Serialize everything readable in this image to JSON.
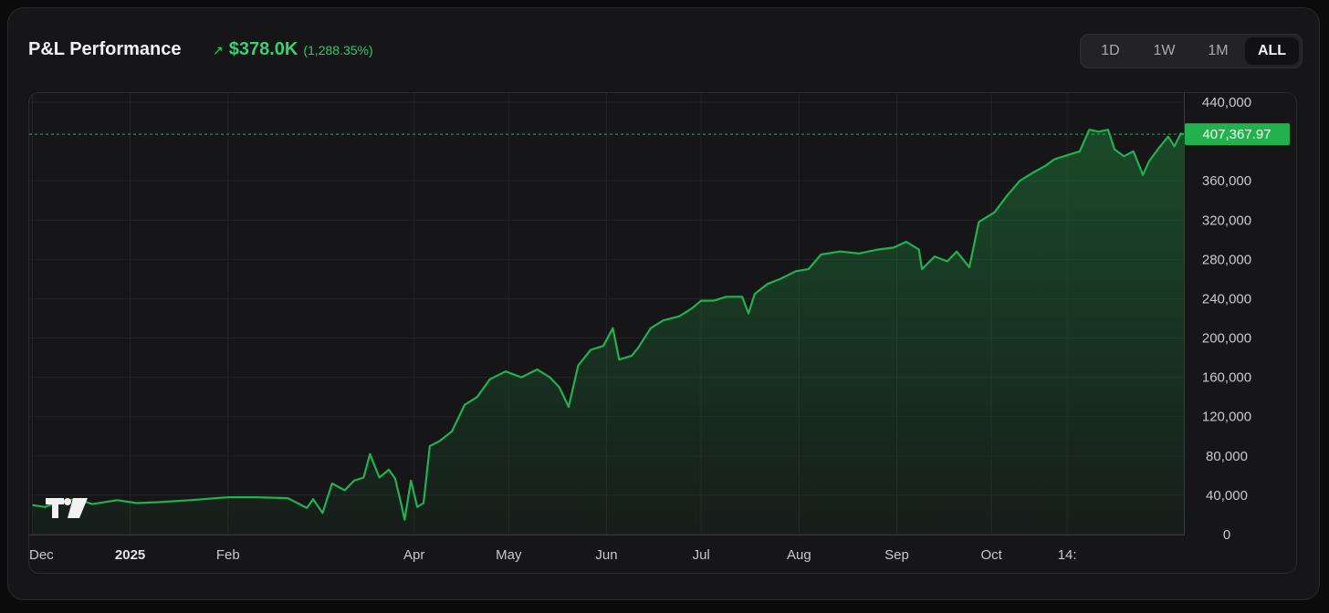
{
  "header": {
    "title": "P&L Performance",
    "trend_icon": "trending-up-icon",
    "pnl_value": "$378.0K",
    "pnl_percent": "(1,288.35%)"
  },
  "range_selector": {
    "options": [
      "1D",
      "1W",
      "1M",
      "ALL"
    ],
    "selected": "ALL"
  },
  "colors": {
    "accent_green": "#22b14c",
    "background": "#161618"
  },
  "chart_data": {
    "type": "area",
    "title": "",
    "xlabel": "",
    "ylabel": "",
    "ylim": [
      0,
      440000
    ],
    "y_ticks": [
      0,
      40000,
      80000,
      120000,
      160000,
      200000,
      240000,
      280000,
      320000,
      360000,
      440000
    ],
    "y_tick_labels": [
      "0",
      "40,000",
      "80,000",
      "120,000",
      "160,000",
      "200,000",
      "240,000",
      "280,000",
      "320,000",
      "360,000",
      "440,000"
    ],
    "x_tick_labels": [
      {
        "label": "Dec",
        "date": "2024-12-01",
        "bold": false
      },
      {
        "label": "2025",
        "date": "2025-01-01",
        "bold": true
      },
      {
        "label": "Feb",
        "date": "2025-02-01",
        "bold": false
      },
      {
        "label": "Apr",
        "date": "2025-04-01",
        "bold": false
      },
      {
        "label": "May",
        "date": "2025-05-01",
        "bold": false
      },
      {
        "label": "Jun",
        "date": "2025-06-01",
        "bold": false
      },
      {
        "label": "Jul",
        "date": "2025-07-01",
        "bold": false
      },
      {
        "label": "Aug",
        "date": "2025-08-01",
        "bold": false
      },
      {
        "label": "Sep",
        "date": "2025-09-01",
        "bold": false
      },
      {
        "label": "Oct",
        "date": "2025-10-01",
        "bold": false
      },
      {
        "label": "14:",
        "date": "2025-10-25",
        "bold": false
      }
    ],
    "grid": true,
    "last_value": 407367.97,
    "last_value_label": "407,367.97",
    "series": [
      {
        "points": [
          [
            "2024-12-01",
            30000
          ],
          [
            "2024-12-05",
            28000
          ],
          [
            "2024-12-10",
            34000
          ],
          [
            "2024-12-15",
            36000
          ],
          [
            "2024-12-20",
            31000
          ],
          [
            "2024-12-28",
            35000
          ],
          [
            "2025-01-03",
            32000
          ],
          [
            "2025-01-10",
            33000
          ],
          [
            "2025-01-20",
            35000
          ],
          [
            "2025-02-01",
            38000
          ],
          [
            "2025-02-10",
            38000
          ],
          [
            "2025-02-20",
            37000
          ],
          [
            "2025-02-26",
            27000
          ],
          [
            "2025-02-28",
            36000
          ],
          [
            "2025-03-03",
            22000
          ],
          [
            "2025-03-06",
            52000
          ],
          [
            "2025-03-10",
            45000
          ],
          [
            "2025-03-13",
            55000
          ],
          [
            "2025-03-16",
            58000
          ],
          [
            "2025-03-18",
            82000
          ],
          [
            "2025-03-21",
            58000
          ],
          [
            "2025-03-24",
            66000
          ],
          [
            "2025-03-26",
            57000
          ],
          [
            "2025-03-28",
            30000
          ],
          [
            "2025-03-29",
            15000
          ],
          [
            "2025-03-31",
            55000
          ],
          [
            "2025-04-02",
            28000
          ],
          [
            "2025-04-04",
            32000
          ],
          [
            "2025-04-06",
            90000
          ],
          [
            "2025-04-09",
            95000
          ],
          [
            "2025-04-13",
            105000
          ],
          [
            "2025-04-17",
            132000
          ],
          [
            "2025-04-21",
            140000
          ],
          [
            "2025-04-25",
            158000
          ],
          [
            "2025-04-30",
            166000
          ],
          [
            "2025-05-05",
            160000
          ],
          [
            "2025-05-10",
            168000
          ],
          [
            "2025-05-14",
            160000
          ],
          [
            "2025-05-17",
            150000
          ],
          [
            "2025-05-20",
            130000
          ],
          [
            "2025-05-23",
            172000
          ],
          [
            "2025-05-27",
            188000
          ],
          [
            "2025-05-31",
            192000
          ],
          [
            "2025-06-03",
            210000
          ],
          [
            "2025-06-05",
            178000
          ],
          [
            "2025-06-09",
            182000
          ],
          [
            "2025-06-11",
            190000
          ],
          [
            "2025-06-15",
            210000
          ],
          [
            "2025-06-19",
            218000
          ],
          [
            "2025-06-24",
            222000
          ],
          [
            "2025-06-28",
            230000
          ],
          [
            "2025-07-01",
            238000
          ],
          [
            "2025-07-05",
            238000
          ],
          [
            "2025-07-09",
            242000
          ],
          [
            "2025-07-14",
            242000
          ],
          [
            "2025-07-16",
            225000
          ],
          [
            "2025-07-18",
            245000
          ],
          [
            "2025-07-22",
            255000
          ],
          [
            "2025-07-26",
            260000
          ],
          [
            "2025-07-31",
            268000
          ],
          [
            "2025-08-04",
            270000
          ],
          [
            "2025-08-08",
            285000
          ],
          [
            "2025-08-14",
            288000
          ],
          [
            "2025-08-20",
            286000
          ],
          [
            "2025-08-26",
            290000
          ],
          [
            "2025-08-31",
            292000
          ],
          [
            "2025-09-04",
            298000
          ],
          [
            "2025-09-08",
            290000
          ],
          [
            "2025-09-09",
            270000
          ],
          [
            "2025-09-13",
            283000
          ],
          [
            "2025-09-17",
            278000
          ],
          [
            "2025-09-20",
            288000
          ],
          [
            "2025-09-24",
            272000
          ],
          [
            "2025-09-27",
            318000
          ],
          [
            "2025-10-02",
            328000
          ],
          [
            "2025-10-06",
            345000
          ],
          [
            "2025-10-10",
            360000
          ],
          [
            "2025-10-14",
            368000
          ],
          [
            "2025-10-18",
            375000
          ],
          [
            "2025-10-21",
            382000
          ],
          [
            "2025-10-25",
            386000
          ],
          [
            "2025-10-29",
            390000
          ],
          [
            "2025-11-01",
            412000
          ],
          [
            "2025-11-04",
            410000
          ],
          [
            "2025-11-07",
            412000
          ],
          [
            "2025-11-09",
            392000
          ],
          [
            "2025-11-12",
            385000
          ],
          [
            "2025-11-15",
            390000
          ],
          [
            "2025-11-18",
            366000
          ],
          [
            "2025-11-20",
            380000
          ],
          [
            "2025-11-23",
            393000
          ],
          [
            "2025-11-26",
            405000
          ],
          [
            "2025-11-28",
            395000
          ],
          [
            "2025-11-30",
            408000
          ],
          [
            "2025-12-01",
            407368
          ]
        ]
      }
    ]
  }
}
